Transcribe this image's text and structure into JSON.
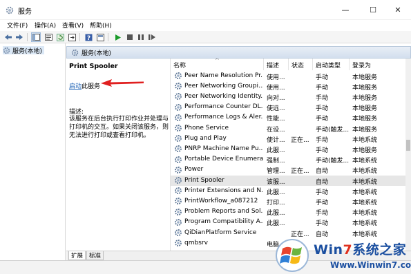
{
  "window": {
    "title": "服务",
    "min_glyph": "—",
    "max_glyph": "☐",
    "close_glyph": "✕"
  },
  "menu": [
    "文件(F)",
    "操作(A)",
    "查看(V)",
    "帮助(H)"
  ],
  "toolbar_icons": [
    "back-icon",
    "forward-icon",
    "show-tree-icon",
    "properties-icon",
    "refresh-icon",
    "export-icon",
    "help-icon",
    "console-icon",
    "start-icon",
    "stop-icon",
    "pause-icon",
    "restart-icon"
  ],
  "tree": {
    "item": "服务(本地)"
  },
  "panel_header": "服务(本地)",
  "detail": {
    "service_title": "Print Spooler",
    "start_link": "启动",
    "start_rest": "此服务",
    "desc_label": "描述:",
    "desc_text": "该服务在后台执行打印作业并处理与打印机的交互。如果关闭该服务，则无法进行打印或查看打印机。"
  },
  "columns": {
    "name": "名称",
    "desc": "描述",
    "status": "状态",
    "startup": "启动类型",
    "logon": "登录为"
  },
  "services": [
    {
      "name": "Peer Name Resolution Pr...",
      "desc": "使用...",
      "status": "",
      "startup": "手动",
      "logon": "本地服务"
    },
    {
      "name": "Peer Networking Groupi...",
      "desc": "使用...",
      "status": "",
      "startup": "手动",
      "logon": "本地服务"
    },
    {
      "name": "Peer Networking Identity...",
      "desc": "向对...",
      "status": "",
      "startup": "手动",
      "logon": "本地服务"
    },
    {
      "name": "Performance Counter DL...",
      "desc": "使远...",
      "status": "",
      "startup": "手动",
      "logon": "本地服务"
    },
    {
      "name": "Performance Logs & Aler...",
      "desc": "性能...",
      "status": "",
      "startup": "手动",
      "logon": "本地服务"
    },
    {
      "name": "Phone Service",
      "desc": "在设...",
      "status": "",
      "startup": "手动(触发...",
      "logon": "本地服务"
    },
    {
      "name": "Plug and Play",
      "desc": "使计...",
      "status": "正在...",
      "startup": "手动",
      "logon": "本地系统"
    },
    {
      "name": "PNRP Machine Name Pu...",
      "desc": "此服...",
      "status": "",
      "startup": "手动",
      "logon": "本地服务"
    },
    {
      "name": "Portable Device Enumera...",
      "desc": "强制...",
      "status": "",
      "startup": "手动(触发...",
      "logon": "本地系统"
    },
    {
      "name": "Power",
      "desc": "管理...",
      "status": "正在...",
      "startup": "自动",
      "logon": "本地系统"
    },
    {
      "name": "Print Spooler",
      "desc": "该服...",
      "status": "",
      "startup": "自动",
      "logon": "本地系统"
    },
    {
      "name": "Printer Extensions and N...",
      "desc": "此服...",
      "status": "",
      "startup": "手动",
      "logon": "本地系统"
    },
    {
      "name": "PrintWorkflow_a087212",
      "desc": "打印...",
      "status": "",
      "startup": "手动",
      "logon": "本地系统"
    },
    {
      "name": "Problem Reports and Sol...",
      "desc": "此服...",
      "status": "",
      "startup": "手动",
      "logon": "本地系统"
    },
    {
      "name": "Program Compatibility A...",
      "desc": "此服...",
      "status": "",
      "startup": "手动",
      "logon": "本地系统"
    },
    {
      "name": "QiDianPlatform Service",
      "desc": "",
      "status": "正在...",
      "startup": "自动",
      "logon": "本地系统"
    },
    {
      "name": "qmbsrv",
      "desc": "电脑...",
      "status": "",
      "startup": "",
      "logon": ""
    }
  ],
  "selected_index": 10,
  "tabs": [
    "扩展",
    "标准"
  ],
  "watermark": {
    "title_a": "Win",
    "title_seven": "7",
    "title_b": "系统之家",
    "url": "Www.Winwin7.com"
  },
  "colors": {
    "link": "#1a5fb4",
    "annotation_arrow": "#e02020",
    "header_bg": "#d3dfee",
    "selected_row": "#e6e6e6",
    "watermark_blue": "#1b4fa0",
    "watermark_red": "#e0301e"
  }
}
